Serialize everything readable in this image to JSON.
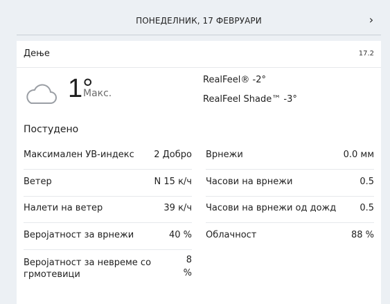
{
  "header": {
    "title": "ПОНЕДЕЛНИК, 17 ФЕВРУАРИ",
    "next_icon": "chevron-right-icon"
  },
  "day": {
    "label": "Дење",
    "date": "17.2",
    "weather_icon": "cloudy-icon",
    "temperature": "1°",
    "temp_label": "Макс.",
    "realfeel": "RealFeel® -2°",
    "realfeel_shade": "RealFeel Shade™ -3°",
    "phrase": "Постудено"
  },
  "details_left": [
    {
      "label": "Максимален УВ-индекс",
      "value": "2 Добро"
    },
    {
      "label": "Ветер",
      "value": "N 15 к/ч"
    },
    {
      "label": "Налети на ветер",
      "value": "39 к/ч"
    },
    {
      "label": "Веројатност за врнежи",
      "value": "40 %"
    },
    {
      "label": "Веројатност за невреме со грмотевици",
      "value": "8 %"
    }
  ],
  "details_right": [
    {
      "label": "Врнежи",
      "value": "0.0 мм"
    },
    {
      "label": "Часови на врнежи",
      "value": "0.5"
    },
    {
      "label": "Часови на врнежи од дожд",
      "value": "0.5"
    },
    {
      "label": "Облачност",
      "value": "88 %"
    }
  ],
  "colors": {
    "page_background": "#ecf0f4",
    "card_background": "#ffffff",
    "divider": "#e6e8eb",
    "text": "#1f1f1f",
    "muted": "#6b6b6b"
  }
}
